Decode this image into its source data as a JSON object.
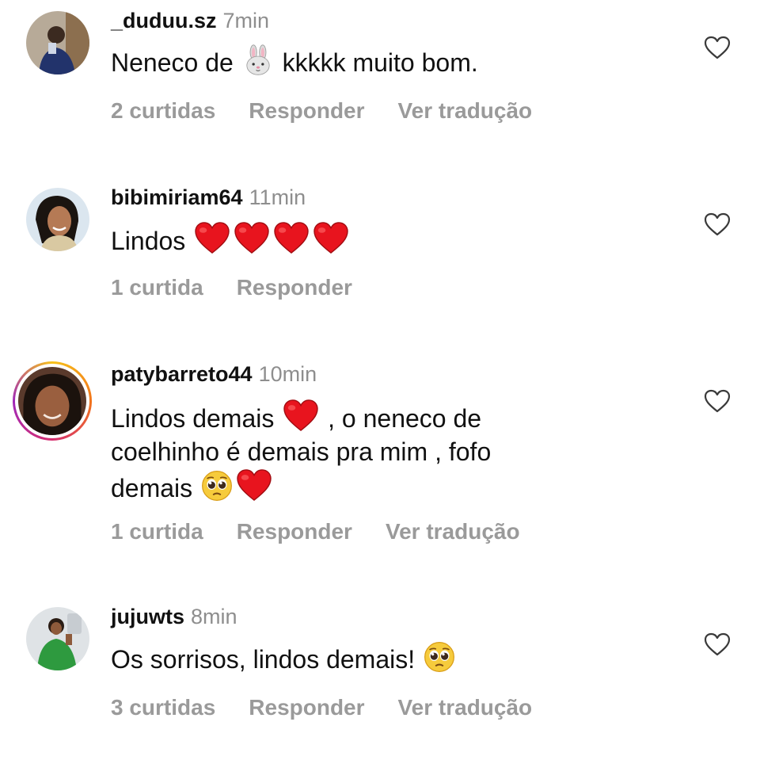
{
  "comments": [
    {
      "username": "_duduu.sz",
      "time": "7min",
      "text_parts": [
        "Neneco de ",
        " kkkkk muito bom."
      ],
      "emojis": [
        "rabbit-face-icon"
      ],
      "likes": "2 curtidas",
      "reply": "Responder",
      "translate": "Ver tradução",
      "story_ring": false
    },
    {
      "username": "bibimiriam64",
      "time": "11min",
      "text_parts": [
        "Lindos "
      ],
      "emojis": [
        "red-heart-icon",
        "red-heart-icon",
        "red-heart-icon",
        "red-heart-icon"
      ],
      "likes": "1 curtida",
      "reply": "Responder",
      "story_ring": false
    },
    {
      "username": "patybarreto44",
      "time": "10min",
      "text_parts": [
        "Lindos demais ",
        " , o neneco de",
        "coelhinho é demais pra mim , fofo",
        "demais "
      ],
      "emojis": [
        "red-heart-icon",
        "pleading-face-icon",
        "red-heart-icon"
      ],
      "likes": "1 curtida",
      "reply": "Responder",
      "translate": "Ver tradução",
      "story_ring": true
    },
    {
      "username": "jujuwts",
      "time": "8min",
      "text_parts": [
        "Os sorrisos, lindos demais! "
      ],
      "emojis": [
        "pleading-face-icon"
      ],
      "likes": "3 curtidas",
      "reply": "Responder",
      "translate": "Ver tradução",
      "story_ring": false
    }
  ],
  "colors": {
    "text": "#111111",
    "muted": "#8e8e8e",
    "heart_red": "#e8141e",
    "story_ring": [
      "#f7c21a",
      "#f2741b",
      "#d62e6f",
      "#a028b8"
    ]
  }
}
